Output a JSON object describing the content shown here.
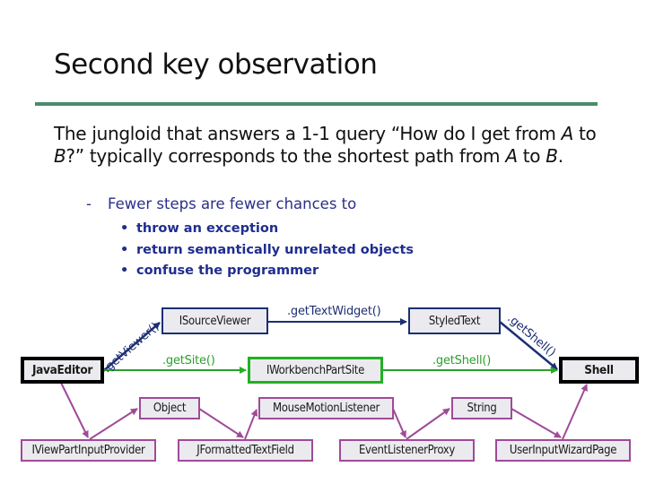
{
  "slide": {
    "title": "Second key observation",
    "rule_color": "#4b8b6a",
    "paragraph": {
      "p1": "The jungloid that answers a 1-1 query “How do I get from ",
      "A1": "A",
      "p2": " to ",
      "B1": "B",
      "p3": "?”  typically corresponds to the shortest path from ",
      "A2": "A",
      "p4": " to ",
      "B2": "B",
      "p5": "."
    },
    "subpoint": {
      "dash": "-",
      "text": "Fewer steps are fewer chances to"
    },
    "bullets": [
      "throw an exception",
      "return semantically unrelated objects",
      "confuse the programmer"
    ],
    "bullet_glyph": "•"
  },
  "diagram": {
    "colors": {
      "blue_path": "#1c2f74",
      "green_path": "#22b022",
      "purple_path": "#a04a98",
      "endpoint_border": "#000000",
      "node_fill": "#ebebef"
    },
    "nodes": {
      "source": "JavaEditor",
      "target": "Shell",
      "isourceviewer": "ISourceViewer",
      "styledtext": "StyledText",
      "iworkbenchpartsite": "IWorkbenchPartSite",
      "object": "Object",
      "mousemotionlistener": "MouseMotionListener",
      "string": "String",
      "iviewpartinputprovider": "IViewPartInputProvider",
      "jformattedtextfield": "JFormattedTextField",
      "eventlistenerproxy": "EventListenerProxy",
      "userinputwizardpage": "UserInputWizardPage"
    },
    "edge_labels": {
      "get_viewer": ".getViewer()",
      "get_text_widget": ".getTextWidget()",
      "get_shell_blue": ".getShell()",
      "get_site": ".getSite()",
      "get_shell_green": ".getShell()"
    }
  }
}
